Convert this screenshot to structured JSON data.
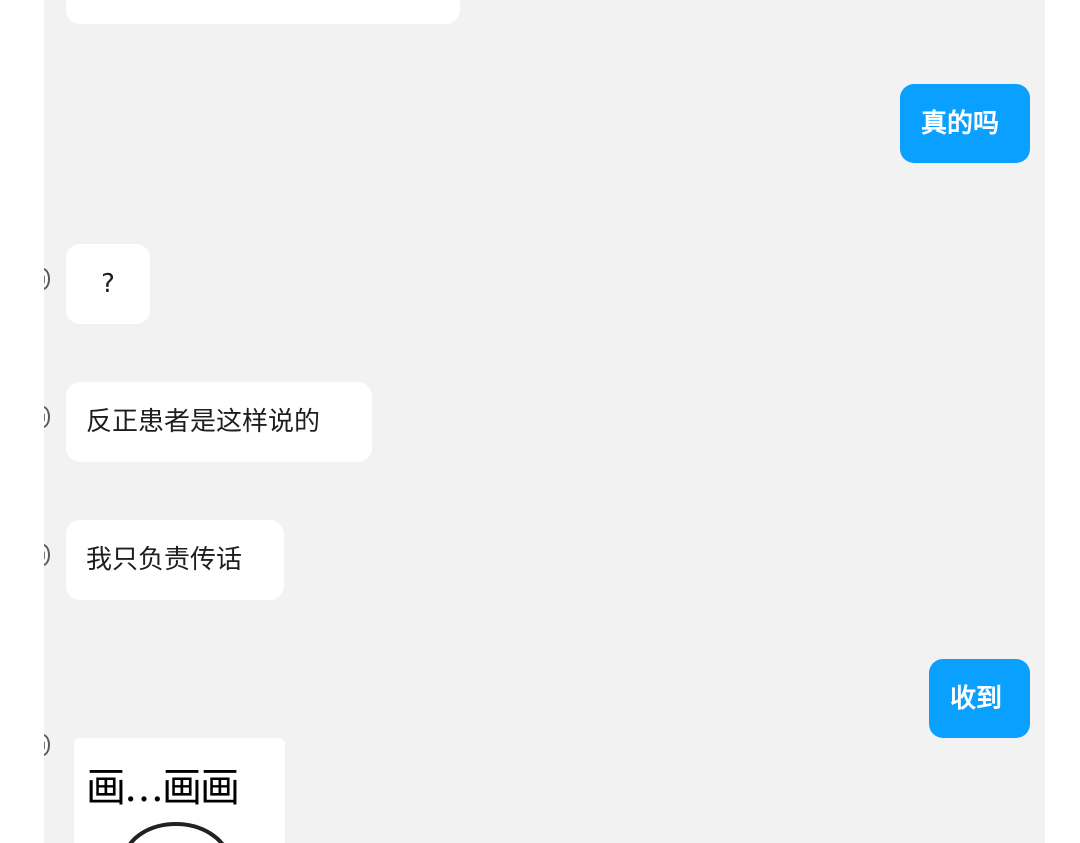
{
  "colors": {
    "chat_background": "#f2f2f2",
    "incoming_bubble": "#ffffff",
    "outgoing_bubble": "#0aa0ff",
    "outgoing_text": "#ffffff"
  },
  "messages": [
    {
      "direction": "incoming",
      "text": ""
    },
    {
      "direction": "outgoing",
      "text": "真的吗"
    },
    {
      "direction": "incoming",
      "text": "?"
    },
    {
      "direction": "incoming",
      "text": "反正患者是这样说的"
    },
    {
      "direction": "incoming",
      "text": "我只负责传话"
    },
    {
      "direction": "outgoing",
      "text": "收到"
    },
    {
      "direction": "incoming",
      "type": "sticker",
      "text": "画…画画",
      "icon": "meme-face-icon"
    }
  ]
}
